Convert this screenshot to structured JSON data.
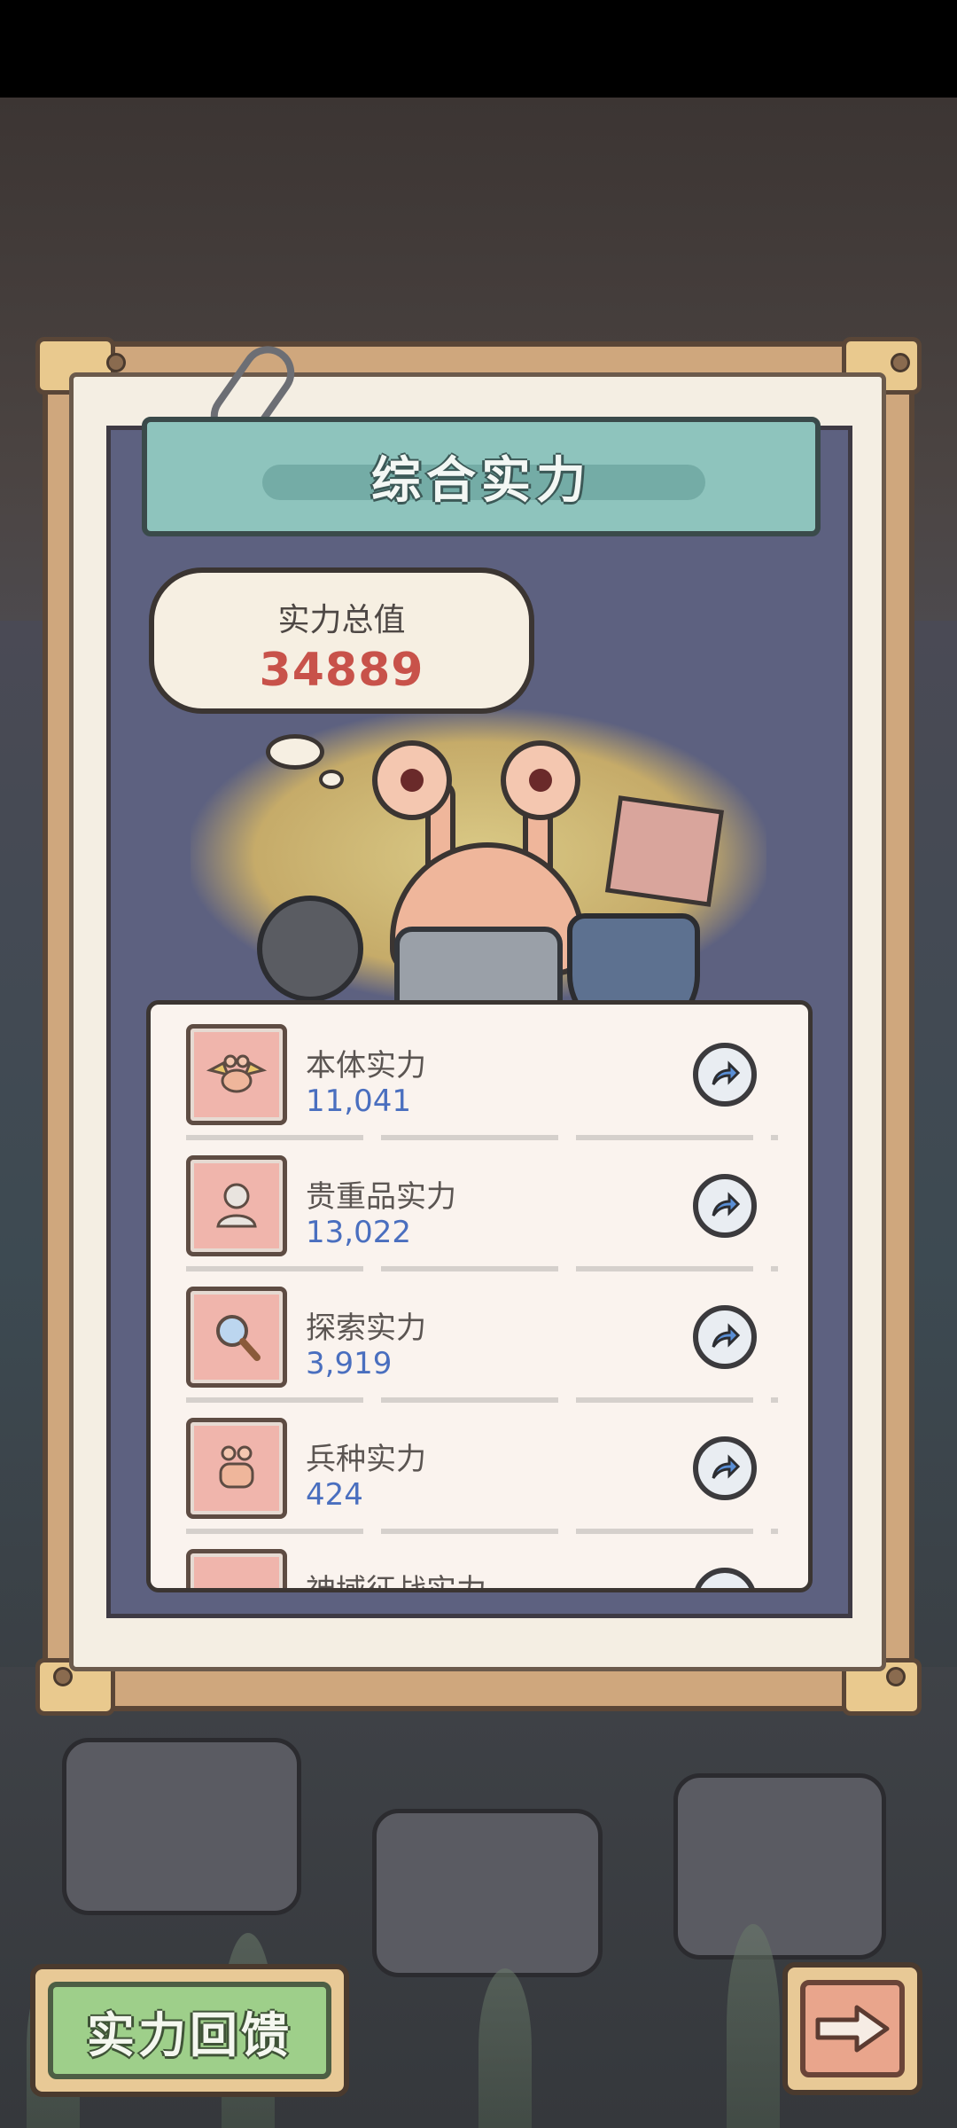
{
  "panel": {
    "title": "综合实力",
    "total_label": "实力总值",
    "total_value": "34889"
  },
  "stats": [
    {
      "title": "本体实力",
      "value": "11,041",
      "icon": "winged-snail-icon"
    },
    {
      "title": "贵重品实力",
      "value": "13,022",
      "icon": "bust-statue-icon"
    },
    {
      "title": "探索实力",
      "value": "3,919",
      "icon": "magnifier-icon"
    },
    {
      "title": "兵种实力",
      "value": "424",
      "icon": "snail-soldier-icon"
    },
    {
      "title": "神域征战实力",
      "value": "",
      "icon": "partial-icon"
    }
  ],
  "buttons": {
    "feedback_label": "实力回馈",
    "next_icon": "right-arrow-icon",
    "share_icon": "share-arrow-icon"
  },
  "colors": {
    "value_blue": "#4a6fbf",
    "total_red": "#c8524a",
    "title_teal": "#8ec4bd",
    "feedback_green": "#9ecf8a"
  }
}
